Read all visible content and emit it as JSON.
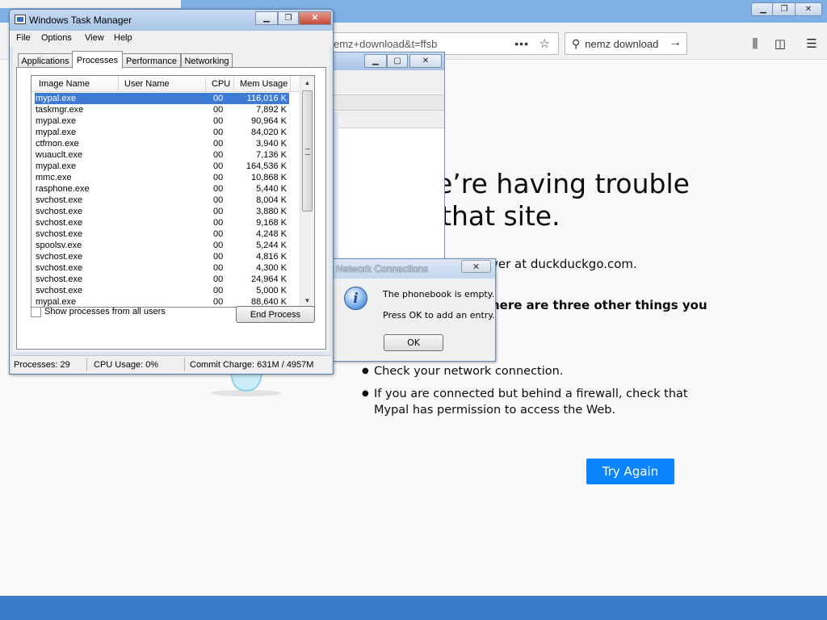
{
  "browser": {
    "url_text": "emz+download&t=ffsb",
    "search_text": "nemz download",
    "error": {
      "title_line1": "e’re having trouble",
      "title_line2": "that site.",
      "description": "ver at duckduckgo.com.",
      "bold_text": "here are three other things you",
      "list": [
        "Check your network connection.",
        "If you are connected but behind a firewall, check that Mypal has permission to access the Web."
      ],
      "try_again_label": "Try Again"
    },
    "colors": {
      "accent": "#0a84ff",
      "background": "#f9f9fa",
      "desktop": "#3a7bc8"
    }
  },
  "network_dialog": {
    "title": "Network Connections",
    "message_line1": "The phonebook is empty.",
    "message_line2": "Press OK to add an entry.",
    "ok_label": "OK",
    "icon": "info-icon"
  },
  "task_manager": {
    "title": "Windows Task Manager",
    "menus": [
      "File",
      "Options",
      "View",
      "Help"
    ],
    "tabs": [
      "Applications",
      "Processes",
      "Performance",
      "Networking"
    ],
    "active_tab": "Processes",
    "columns": [
      "Image Name",
      "User Name",
      "CPU",
      "Mem Usage"
    ],
    "processes": [
      {
        "name": "mypal.exe",
        "cpu": "00",
        "mem": "116,016 K"
      },
      {
        "name": "taskmgr.exe",
        "cpu": "00",
        "mem": "7,892 K"
      },
      {
        "name": "mypal.exe",
        "cpu": "00",
        "mem": "90,964 K"
      },
      {
        "name": "mypal.exe",
        "cpu": "00",
        "mem": "84,020 K"
      },
      {
        "name": "ctfmon.exe",
        "cpu": "00",
        "mem": "3,940 K"
      },
      {
        "name": "wuauclt.exe",
        "cpu": "00",
        "mem": "7,136 K"
      },
      {
        "name": "mypal.exe",
        "cpu": "00",
        "mem": "164,536 K"
      },
      {
        "name": "mmc.exe",
        "cpu": "00",
        "mem": "10,868 K"
      },
      {
        "name": "rasphone.exe",
        "cpu": "00",
        "mem": "5,440 K"
      },
      {
        "name": "svchost.exe",
        "cpu": "00",
        "mem": "8,004 K"
      },
      {
        "name": "svchost.exe",
        "cpu": "00",
        "mem": "3,880 K"
      },
      {
        "name": "svchost.exe",
        "cpu": "00",
        "mem": "9,168 K"
      },
      {
        "name": "svchost.exe",
        "cpu": "00",
        "mem": "4,248 K"
      },
      {
        "name": "spoolsv.exe",
        "cpu": "00",
        "mem": "5,244 K"
      },
      {
        "name": "svchost.exe",
        "cpu": "00",
        "mem": "4,816 K"
      },
      {
        "name": "svchost.exe",
        "cpu": "00",
        "mem": "4,300 K"
      },
      {
        "name": "svchost.exe",
        "cpu": "00",
        "mem": "24,964 K"
      },
      {
        "name": "svchost.exe",
        "cpu": "00",
        "mem": "5,000 K"
      },
      {
        "name": "mypal.exe",
        "cpu": "00",
        "mem": "88,640 K"
      }
    ],
    "selected_index": 0,
    "show_all_label": "Show processes from all users",
    "show_all_checked": false,
    "end_process_label": "End Process",
    "status": {
      "processes": "Processes: 29",
      "cpu": "CPU Usage: 0%",
      "commit": "Commit Charge: 631M / 4957M"
    }
  }
}
